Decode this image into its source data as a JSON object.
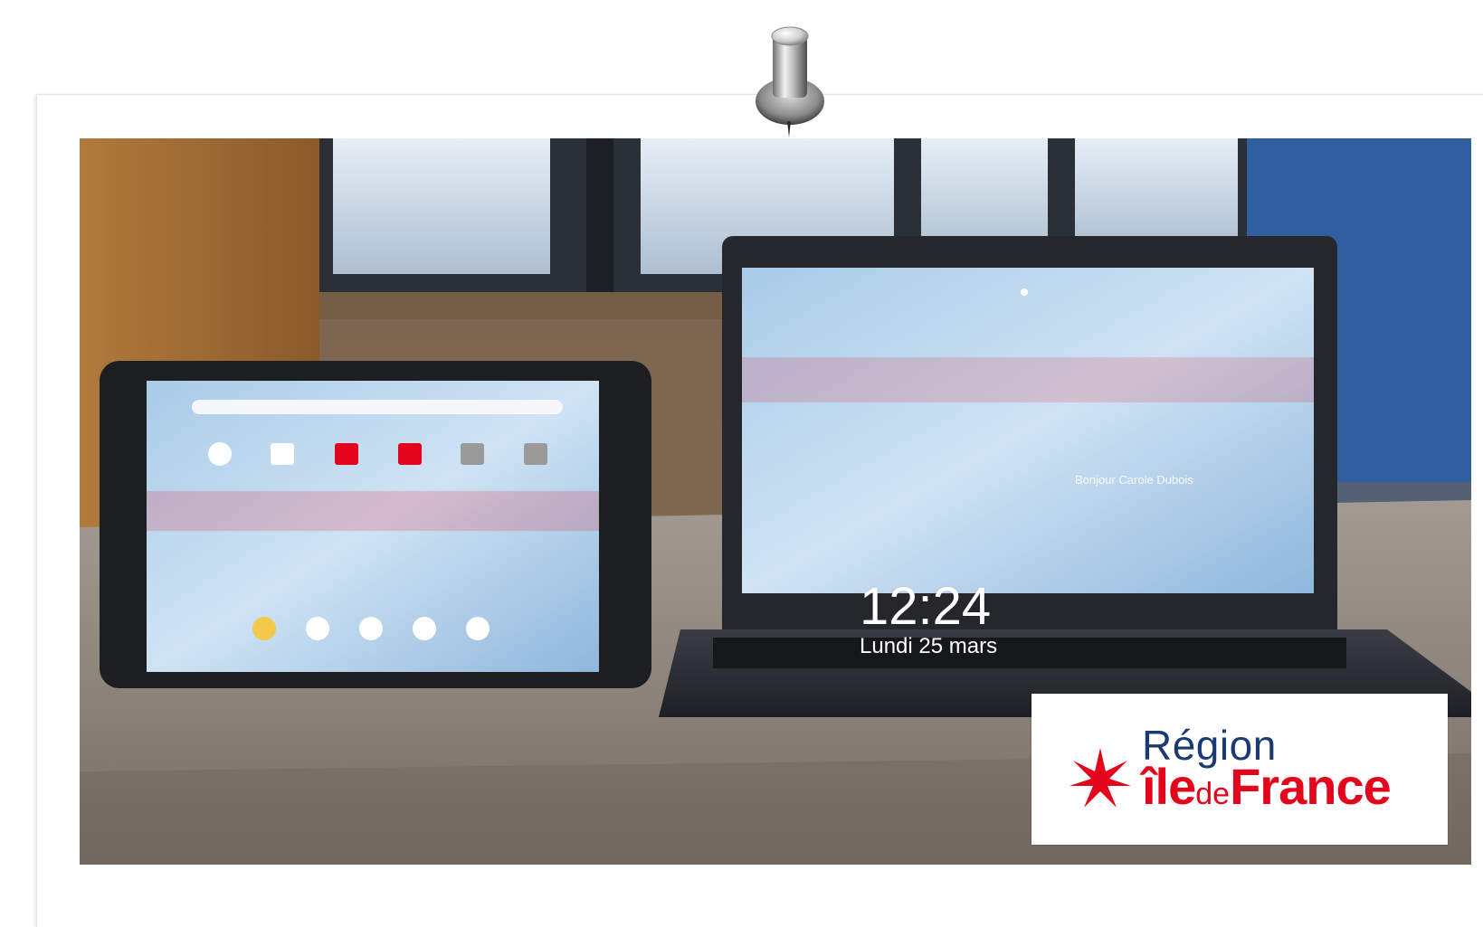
{
  "photo": {
    "subject": "tablet-and-laptop-on-table"
  },
  "laptop_screen": {
    "greeting": "Bonjour Carole Dubois",
    "time": "12:24",
    "date": "Lundi 25 mars"
  },
  "logo": {
    "line1": "Région",
    "line2_part1": "île",
    "line2_part2": "de",
    "line2_part3": "France",
    "accent_color": "#e3051b",
    "navy_color": "#1b3a73"
  }
}
